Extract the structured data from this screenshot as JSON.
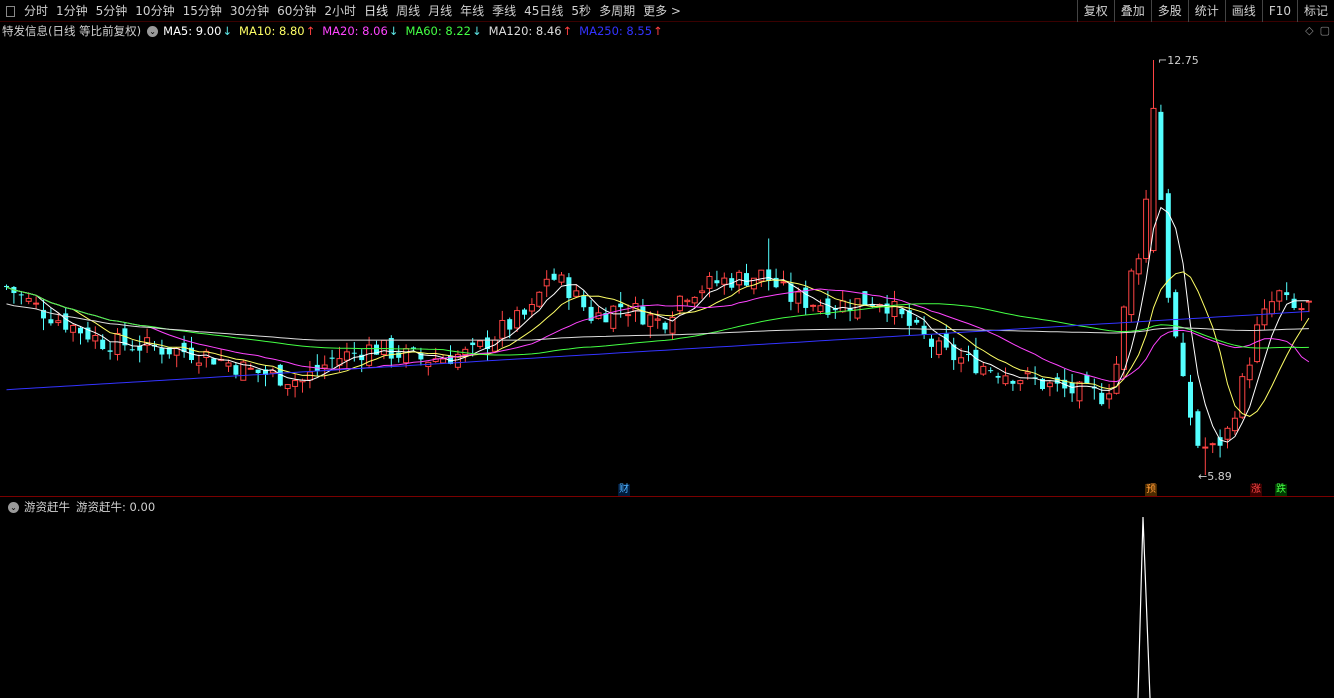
{
  "toolbar": {
    "periods": [
      "分时",
      "1分钟",
      "5分钟",
      "10分钟",
      "15分钟",
      "30分钟",
      "60分钟",
      "2小时",
      "日线",
      "周线",
      "月线",
      "年线",
      "季线",
      "45日线",
      "5秒",
      "多周期",
      "更多 >"
    ],
    "active_period": "日线",
    "right_buttons": [
      "复权",
      "叠加",
      "多股",
      "统计",
      "画线",
      "F10",
      "标记"
    ]
  },
  "legend": {
    "title": "特发信息(日线 等比前复权)",
    "items": [
      {
        "label": "MA5: 9.00",
        "color": "#ffffff",
        "arrow": "↓"
      },
      {
        "label": "MA10: 8.80",
        "color": "#ffff66",
        "arrow": "↑"
      },
      {
        "label": "MA20: 8.06",
        "color": "#ff44ff",
        "arrow": "↓"
      },
      {
        "label": "MA60: 8.22",
        "color": "#44ff44",
        "arrow": "↓"
      },
      {
        "label": "MA120: 8.46",
        "color": "#dddddd",
        "arrow": "↑"
      },
      {
        "label": "MA250: 8.55",
        "color": "#3333ff",
        "arrow": "↑"
      }
    ]
  },
  "chart_annotations": {
    "high_label": "12.75",
    "low_label": "5.89",
    "markers": [
      {
        "text": "财",
        "color": "#4fb3ff"
      },
      {
        "text": "预",
        "color": "#ff9933"
      },
      {
        "text": "涨",
        "color": "#ff4444"
      },
      {
        "text": "跌",
        "color": "#44ff44"
      }
    ]
  },
  "subchart": {
    "title": "游资赶牛",
    "value_label": "游资赶牛: 0.00"
  },
  "colors": {
    "up": "#ff4444",
    "down": "#54ffff",
    "background": "#000000"
  },
  "chart_data": {
    "type": "candlestick",
    "high": 12.75,
    "low": 5.89,
    "ma_values": {
      "MA5": 9.0,
      "MA10": 8.8,
      "MA20": 8.06,
      "MA60": 8.22,
      "MA120": 8.46,
      "MA250": 8.55
    }
  }
}
